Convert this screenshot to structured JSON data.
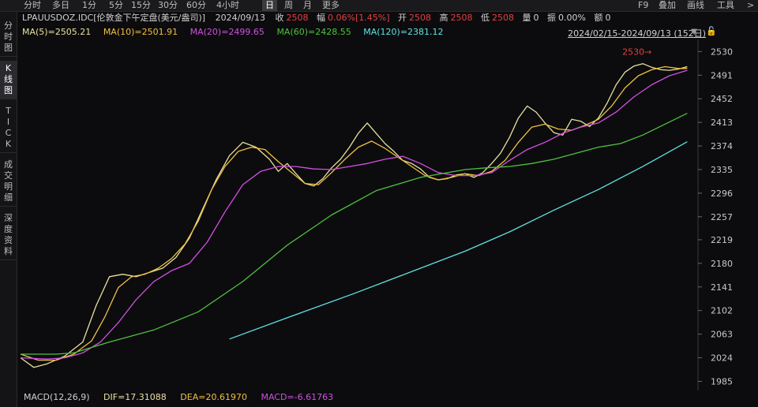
{
  "toolbar": {
    "periods": [
      "分时",
      "多日",
      "1分",
      "5分",
      "15分",
      "30分",
      "60分",
      "4小时",
      "日",
      "周",
      "月",
      "更多"
    ],
    "active_period": "日",
    "right_tools": [
      "F9",
      "叠加",
      "画线",
      "工具",
      ">"
    ]
  },
  "sidebar": {
    "items": [
      "分时图",
      "K线图",
      "TICK",
      "成交明细",
      "深度资料"
    ],
    "active": "K线图"
  },
  "info": {
    "symbol": "LPAUUSDOZ.IDC[伦敦金下午定盘(美元/盎司)]",
    "date": "2024/09/13",
    "close_label": "收",
    "close": "2508",
    "change_label": "幅",
    "change": "0.06%[1.45%]",
    "open_label": "开",
    "open": "2508",
    "high_label": "高",
    "high": "2508",
    "low_label": "低",
    "low": "2508",
    "volume_label": "量",
    "volume": "0",
    "amplitude_label": "振",
    "amplitude": "0.00%",
    "amount_label": "额",
    "amount": "0"
  },
  "ma_legend": [
    {
      "text": "MA(5)=2505.21",
      "color": "#e8e0a0"
    },
    {
      "text": "MA(10)=2501.91",
      "color": "#f0c040"
    },
    {
      "text": "MA(20)=2499.65",
      "color": "#d050e0"
    },
    {
      "text": "MA(60)=2428.55",
      "color": "#50c040"
    },
    {
      "text": "MA(120)=2381.12",
      "color": "#60e0e0"
    }
  ],
  "range_label": "2024/02/15-2024/09/13 (152日)",
  "macd_legend": {
    "macd_params": "MACD(12,26,9)",
    "dif": "DIF=17.31088",
    "dea": "DEA=20.61970",
    "macd": "MACD=-6.61763"
  },
  "chart_data": {
    "type": "line",
    "y_ticks": [
      2530,
      2491,
      2452,
      2413,
      2374,
      2335,
      2296,
      2257,
      2219,
      2180,
      2141,
      2102,
      2063,
      2024,
      1985
    ],
    "ylim": [
      1970,
      2550
    ],
    "x_count": 152,
    "annotation": {
      "text": "2530→",
      "value": 2530,
      "color": "#e04040"
    },
    "series": [
      {
        "key": "ma5",
        "color": "#e8e0a0",
        "points": [
          [
            0,
            2024
          ],
          [
            3,
            2008
          ],
          [
            6,
            2014
          ],
          [
            10,
            2027
          ],
          [
            14,
            2050
          ],
          [
            17,
            2110
          ],
          [
            20,
            2158
          ],
          [
            23,
            2162
          ],
          [
            26,
            2158
          ],
          [
            29,
            2165
          ],
          [
            32,
            2172
          ],
          [
            35,
            2190
          ],
          [
            38,
            2222
          ],
          [
            41,
            2270
          ],
          [
            44,
            2318
          ],
          [
            47,
            2358
          ],
          [
            50,
            2380
          ],
          [
            53,
            2372
          ],
          [
            56,
            2352
          ],
          [
            58,
            2332
          ],
          [
            60,
            2345
          ],
          [
            62,
            2328
          ],
          [
            64,
            2312
          ],
          [
            66,
            2308
          ],
          [
            68,
            2320
          ],
          [
            70,
            2338
          ],
          [
            72,
            2352
          ],
          [
            74,
            2372
          ],
          [
            76,
            2395
          ],
          [
            78,
            2412
          ],
          [
            80,
            2395
          ],
          [
            82,
            2378
          ],
          [
            84,
            2365
          ],
          [
            86,
            2350
          ],
          [
            88,
            2345
          ],
          [
            90,
            2336
          ],
          [
            92,
            2322
          ],
          [
            94,
            2318
          ],
          [
            96,
            2320
          ],
          [
            98,
            2326
          ],
          [
            100,
            2328
          ],
          [
            102,
            2322
          ],
          [
            104,
            2330
          ],
          [
            106,
            2345
          ],
          [
            108,
            2362
          ],
          [
            110,
            2388
          ],
          [
            112,
            2420
          ],
          [
            114,
            2440
          ],
          [
            116,
            2430
          ],
          [
            118,
            2412
          ],
          [
            120,
            2396
          ],
          [
            122,
            2392
          ],
          [
            124,
            2418
          ],
          [
            126,
            2415
          ],
          [
            128,
            2406
          ],
          [
            130,
            2420
          ],
          [
            132,
            2445
          ],
          [
            134,
            2475
          ],
          [
            136,
            2496
          ],
          [
            138,
            2506
          ],
          [
            140,
            2510
          ],
          [
            142,
            2504
          ],
          [
            144,
            2500
          ],
          [
            146,
            2499
          ],
          [
            148,
            2501
          ],
          [
            150,
            2505
          ]
        ]
      },
      {
        "key": "ma10",
        "color": "#f0c040",
        "points": [
          [
            0,
            2030
          ],
          [
            4,
            2020
          ],
          [
            8,
            2020
          ],
          [
            12,
            2030
          ],
          [
            16,
            2052
          ],
          [
            19,
            2092
          ],
          [
            22,
            2140
          ],
          [
            25,
            2158
          ],
          [
            28,
            2162
          ],
          [
            31,
            2172
          ],
          [
            34,
            2188
          ],
          [
            37,
            2212
          ],
          [
            40,
            2250
          ],
          [
            43,
            2302
          ],
          [
            46,
            2340
          ],
          [
            49,
            2365
          ],
          [
            52,
            2372
          ],
          [
            55,
            2368
          ],
          [
            58,
            2348
          ],
          [
            61,
            2330
          ],
          [
            64,
            2312
          ],
          [
            67,
            2310
          ],
          [
            70,
            2330
          ],
          [
            73,
            2352
          ],
          [
            76,
            2372
          ],
          [
            79,
            2382
          ],
          [
            82,
            2370
          ],
          [
            85,
            2355
          ],
          [
            88,
            2340
          ],
          [
            91,
            2325
          ],
          [
            94,
            2318
          ],
          [
            97,
            2322
          ],
          [
            100,
            2328
          ],
          [
            103,
            2325
          ],
          [
            106,
            2332
          ],
          [
            109,
            2350
          ],
          [
            112,
            2380
          ],
          [
            115,
            2405
          ],
          [
            118,
            2410
          ],
          [
            121,
            2402
          ],
          [
            124,
            2400
          ],
          [
            127,
            2408
          ],
          [
            130,
            2418
          ],
          [
            133,
            2440
          ],
          [
            136,
            2470
          ],
          [
            139,
            2490
          ],
          [
            142,
            2500
          ],
          [
            145,
            2505
          ],
          [
            148,
            2502
          ],
          [
            150,
            2502
          ]
        ]
      },
      {
        "key": "ma20",
        "color": "#d050e0",
        "points": [
          [
            0,
            2024
          ],
          [
            6,
            2022
          ],
          [
            10,
            2024
          ],
          [
            14,
            2032
          ],
          [
            18,
            2050
          ],
          [
            22,
            2082
          ],
          [
            26,
            2120
          ],
          [
            30,
            2150
          ],
          [
            34,
            2168
          ],
          [
            38,
            2180
          ],
          [
            42,
            2215
          ],
          [
            46,
            2265
          ],
          [
            50,
            2310
          ],
          [
            54,
            2332
          ],
          [
            58,
            2340
          ],
          [
            62,
            2340
          ],
          [
            66,
            2336
          ],
          [
            70,
            2335
          ],
          [
            74,
            2340
          ],
          [
            78,
            2345
          ],
          [
            82,
            2352
          ],
          [
            86,
            2357
          ],
          [
            90,
            2345
          ],
          [
            94,
            2330
          ],
          [
            98,
            2325
          ],
          [
            102,
            2325
          ],
          [
            106,
            2330
          ],
          [
            110,
            2350
          ],
          [
            114,
            2368
          ],
          [
            118,
            2380
          ],
          [
            122,
            2395
          ],
          [
            126,
            2405
          ],
          [
            130,
            2412
          ],
          [
            134,
            2430
          ],
          [
            138,
            2455
          ],
          [
            142,
            2475
          ],
          [
            146,
            2490
          ],
          [
            150,
            2499
          ]
        ]
      },
      {
        "key": "ma60",
        "color": "#50c040",
        "points": [
          [
            0,
            2030
          ],
          [
            8,
            2030
          ],
          [
            12,
            2032
          ],
          [
            20,
            2050
          ],
          [
            30,
            2070
          ],
          [
            40,
            2100
          ],
          [
            50,
            2150
          ],
          [
            60,
            2210
          ],
          [
            70,
            2260
          ],
          [
            80,
            2300
          ],
          [
            90,
            2322
          ],
          [
            100,
            2335
          ],
          [
            105,
            2338
          ],
          [
            110,
            2340
          ],
          [
            115,
            2345
          ],
          [
            120,
            2352
          ],
          [
            125,
            2362
          ],
          [
            130,
            2372
          ],
          [
            135,
            2378
          ],
          [
            140,
            2392
          ],
          [
            145,
            2410
          ],
          [
            150,
            2428
          ]
        ]
      },
      {
        "key": "ma120",
        "color": "#60e0e0",
        "points": [
          [
            47,
            2055
          ],
          [
            60,
            2090
          ],
          [
            75,
            2130
          ],
          [
            90,
            2172
          ],
          [
            100,
            2200
          ],
          [
            110,
            2232
          ],
          [
            120,
            2268
          ],
          [
            130,
            2302
          ],
          [
            140,
            2340
          ],
          [
            150,
            2381
          ]
        ]
      }
    ]
  }
}
